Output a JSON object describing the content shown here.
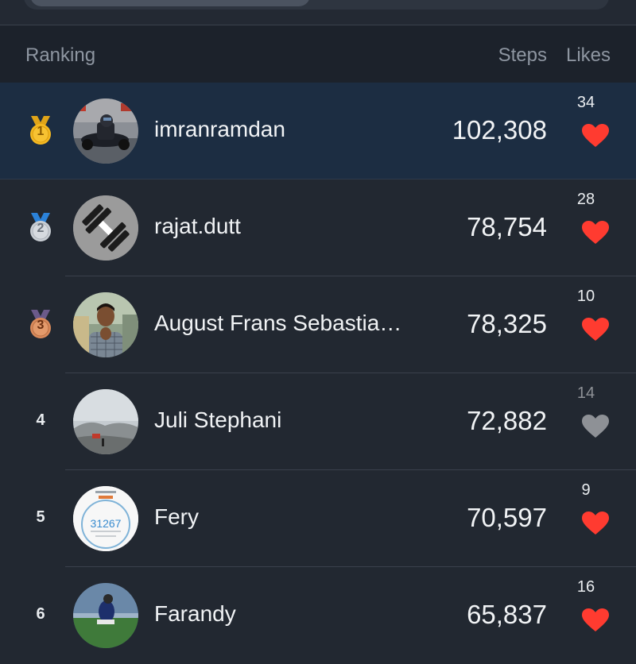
{
  "header": {
    "ranking_label": "Ranking",
    "steps_label": "Steps",
    "likes_label": "Likes"
  },
  "colors": {
    "highlight_row": "#1c2d42",
    "heart_liked": "#ff3b30",
    "heart_unliked": "#8e9196",
    "gold": "#f5b921",
    "silver": "#c9ced4",
    "bronze": "#d98a5b",
    "ribbon_blue": "#2b82d9"
  },
  "rows": [
    {
      "rank": "1",
      "medal": "gold",
      "name": "imranramdan",
      "steps": "102,308",
      "likes": "34",
      "liked": true,
      "avatar": "go-kart-photo"
    },
    {
      "rank": "2",
      "medal": "silver",
      "name": "rajat.dutt",
      "steps": "78,754",
      "likes": "28",
      "liked": true,
      "avatar": "dumbbell-icon"
    },
    {
      "rank": "3",
      "medal": "bronze",
      "name": "August Frans Sebastia…",
      "steps": "78,325",
      "likes": "10",
      "liked": true,
      "avatar": "person-photo"
    },
    {
      "rank": "4",
      "medal": null,
      "name": "Juli Stephani",
      "steps": "72,882",
      "likes": "14",
      "liked": false,
      "avatar": "mountain-photo"
    },
    {
      "rank": "5",
      "medal": null,
      "name": "Fery",
      "steps": "70,597",
      "likes": "9",
      "liked": true,
      "avatar": "step-counter-screenshot",
      "avatar_text": "31267"
    },
    {
      "rank": "6",
      "medal": null,
      "name": "Farandy",
      "steps": "65,837",
      "likes": "16",
      "liked": true,
      "avatar": "soccer-photo"
    }
  ]
}
